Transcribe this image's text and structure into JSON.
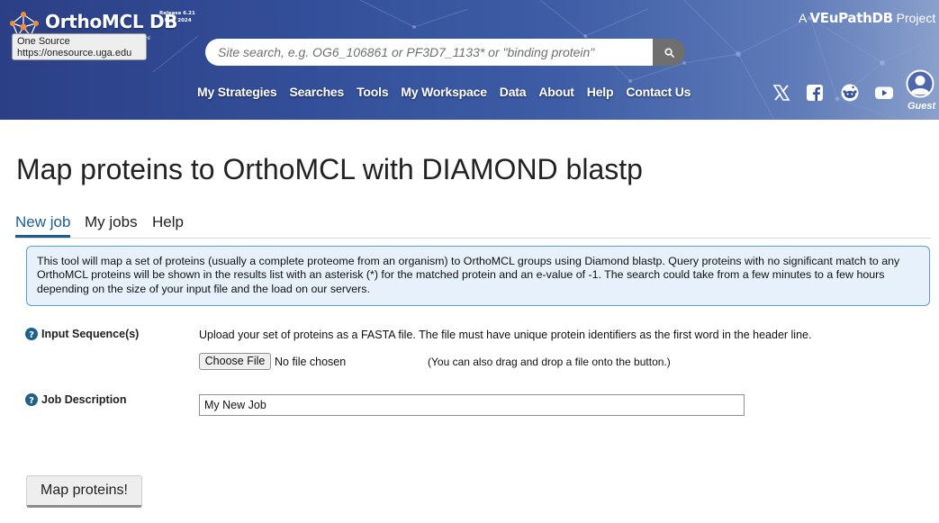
{
  "header": {
    "logo_text": "OrthoMCL DB",
    "release_line1": "Release 6.21",
    "release_line2": "7 May 2024",
    "subtitle_fragment": "es",
    "tooltip_title": "One Source",
    "tooltip_url": "https://onesource.uga.edu",
    "project_prefix": "A",
    "project_brand": "VEuPathDB",
    "project_suffix": "Project",
    "search_placeholder": "Site search, e.g. OG6_106861 or PF3D7_1133* or \"binding protein\"",
    "nav": [
      "My Strategies",
      "Searches",
      "Tools",
      "My Workspace",
      "Data",
      "About",
      "Help",
      "Contact Us"
    ],
    "social_icons": [
      "x-icon",
      "facebook-icon",
      "reddit-icon",
      "youtube-icon"
    ],
    "guest_label": "Guest"
  },
  "main": {
    "title": "Map proteins to OrthoMCL with DIAMOND blastp",
    "tabs": [
      "New job",
      "My jobs",
      "Help"
    ],
    "active_tab": "New job",
    "info_text": "This tool will map a set of proteins (usually a complete proteome from an organism) to OrthoMCL groups using Diamond blastp. Query proteins with no significant match to any OrthoMCL proteins will be shown in the results list with an asterisk (*) for the matched protein and an e-value of -1. The search could take from a few minutes to a few hours depending on the size of your input file and the load on our servers.",
    "input_label": "Input Sequence(s)",
    "input_help": "Upload your set of proteins as a FASTA file. The file must have unique protein identifiers as the first word in the header line.",
    "choose_file_label": "Choose File",
    "file_status": "No file chosen",
    "drag_note": "(You can also drag and drop a file onto the button.)",
    "job_desc_label": "Job Description",
    "job_desc_value": "My New Job",
    "submit_label": "Map proteins!"
  },
  "colors": {
    "header_blue": "#34509a",
    "tab_active": "#1c5d8f",
    "info_bg": "#e6f1fb",
    "info_border": "#5aa0d2",
    "help_icon": "#1f5f8b"
  }
}
